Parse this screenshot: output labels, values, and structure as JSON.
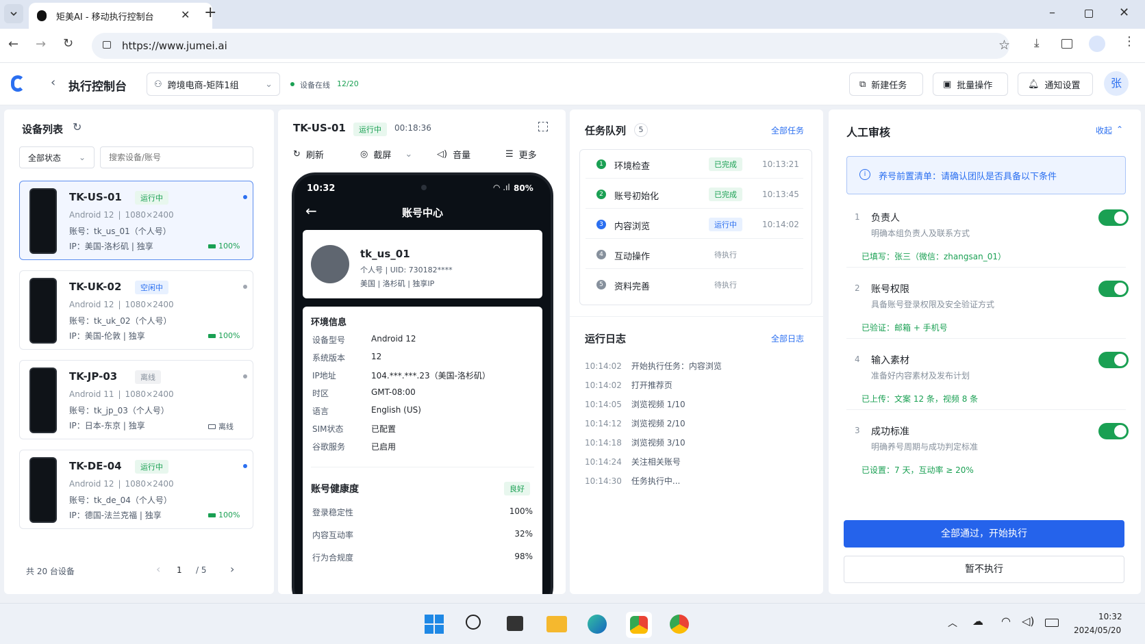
{
  "browser": {
    "tab_title": "矩美AI - 移动执行控制台",
    "url": "https://www.jumei.ai"
  },
  "header": {
    "back_title": "执行控制台",
    "team": "跨境电商-矩阵1组",
    "online_label": "设备在线",
    "online_count": "12/20",
    "new_task": "新建任务",
    "batch": "批量操作",
    "notify": "通知设置",
    "avatar": "张"
  },
  "devices": {
    "title": "设备列表",
    "filter": "全部状态",
    "search_placeholder": "搜索设备/账号",
    "items": [
      {
        "name": "TK-US-01",
        "status": "运行中",
        "os": "Android 12",
        "res": "1080×2400",
        "account": "账号：tk_us_01（个人号）",
        "ip": "IP：美国-洛杉矶 | 独享",
        "battery": "100%"
      },
      {
        "name": "TK-UK-02",
        "status": "空闲中",
        "os": "Android 12",
        "res": "1080×2400",
        "account": "账号：tk_uk_02（个人号）",
        "ip": "IP：美国-伦敦 | 独享",
        "battery": "100%"
      },
      {
        "name": "TK-JP-03",
        "status": "离线",
        "os": "Android 11",
        "res": "1080×2400",
        "account": "账号：tk_jp_03（个人号）",
        "ip": "IP：日本-东京 | 独享",
        "battery": "离线"
      },
      {
        "name": "TK-DE-04",
        "status": "运行中",
        "os": "Android 12",
        "res": "1080×2400",
        "account": "账号：tk_de_04（个人号）",
        "ip": "IP：德国-法兰克福 | 独享",
        "battery": "100%"
      }
    ],
    "total": "共 20 台设备",
    "page": "1",
    "pages": "/ 5"
  },
  "screen": {
    "device": "TK-US-01",
    "status": "运行中",
    "elapsed": "00:18:36",
    "tools": {
      "refresh": "刷新",
      "capture": "截屏",
      "volume": "音量",
      "more": "更多"
    },
    "phone": {
      "time": "10:32",
      "battery": "80%",
      "title": "账号中心",
      "username": "tk_us_01",
      "line1": "个人号 | UID: 730182****",
      "line2": "美国 | 洛杉矶 | 独享IP",
      "env_title": "环境信息",
      "env": [
        {
          "k": "设备型号",
          "v": "Android 12"
        },
        {
          "k": "系统版本",
          "v": "12"
        },
        {
          "k": "IP地址",
          "v": "104.***.***.23（美国-洛杉矶）"
        },
        {
          "k": "时区",
          "v": "GMT-08:00"
        },
        {
          "k": "语言",
          "v": "English (US)"
        },
        {
          "k": "SIM状态",
          "v": "已配置"
        },
        {
          "k": "谷歌服务",
          "v": "已启用"
        }
      ],
      "health_title": "账号健康度",
      "health_badge": "良好",
      "health": [
        {
          "k": "登录稳定性",
          "v": "100%"
        },
        {
          "k": "内容互动率",
          "v": "32%"
        },
        {
          "k": "行为合规度",
          "v": "98%"
        }
      ]
    }
  },
  "queue": {
    "title": "任务队列",
    "count": "5",
    "all": "全部任务",
    "tasks": [
      {
        "num": "1",
        "name": "环境检查",
        "status": "已完成",
        "time": "10:13:21"
      },
      {
        "num": "2",
        "name": "账号初始化",
        "status": "已完成",
        "time": "10:13:45"
      },
      {
        "num": "3",
        "name": "内容浏览",
        "status": "运行中",
        "time": "10:14:02"
      },
      {
        "num": "4",
        "name": "互动操作",
        "status": "待执行",
        "time": ""
      },
      {
        "num": "5",
        "name": "资料完善",
        "status": "待执行",
        "time": ""
      }
    ],
    "log_title": "运行日志",
    "log_all": "全部日志",
    "logs": [
      {
        "t": "10:14:02",
        "m": "开始执行任务：内容浏览"
      },
      {
        "t": "10:14:02",
        "m": "打开推荐页"
      },
      {
        "t": "10:14:05",
        "m": "浏览视频 1/10"
      },
      {
        "t": "10:14:12",
        "m": "浏览视频 2/10"
      },
      {
        "t": "10:14:18",
        "m": "浏览视频 3/10"
      },
      {
        "t": "10:14:24",
        "m": "关注相关账号"
      },
      {
        "t": "10:14:30",
        "m": "任务执行中..."
      }
    ]
  },
  "review": {
    "title": "人工审核",
    "collapse": "收起",
    "notice": "养号前置清单：请确认团队是否具备以下条件",
    "items": [
      {
        "num": "1",
        "title": "负责人",
        "desc": "明确本组负责人及联系方式",
        "note": "已填写：张三（微信：zhangsan_01）"
      },
      {
        "num": "2",
        "title": "账号权限",
        "desc": "具备账号登录权限及安全验证方式",
        "note": "已验证：邮箱 + 手机号"
      },
      {
        "num": "4",
        "title": "输入素材",
        "desc": "准备好内容素材及发布计划",
        "note": "已上传：文案 12 条，视频 8 条"
      },
      {
        "num": "3",
        "title": "成功标准",
        "desc": "明确养号周期与成功判定标准",
        "note": "已设置：7 天，互动率 ≥ 20%"
      }
    ],
    "approve": "全部通过，开始执行",
    "defer": "暂不执行"
  },
  "taskbar": {
    "time": "10:32",
    "date": "2024/05/20"
  },
  "colors": {
    "primary": "#2b6ff0",
    "success": "#1aa053",
    "approve_btn": "#2563eb"
  }
}
